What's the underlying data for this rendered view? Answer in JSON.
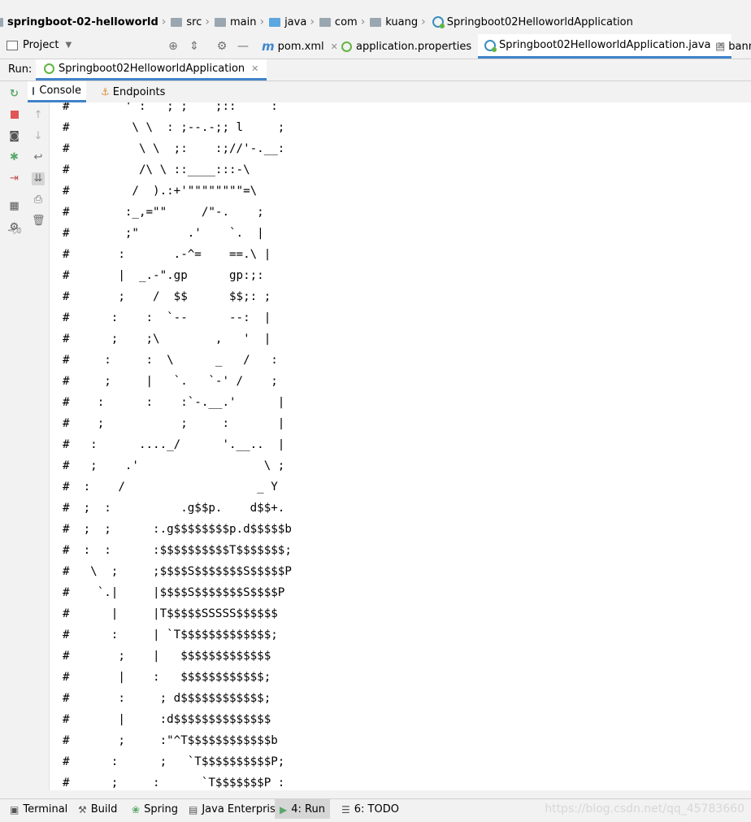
{
  "breadcrumbs": {
    "items": [
      {
        "label": "springboot-02-helloworld"
      },
      {
        "label": "src"
      },
      {
        "label": "main"
      },
      {
        "label": "java"
      },
      {
        "label": "com"
      },
      {
        "label": "kuang"
      },
      {
        "label": "Springboot02HelloworldApplication"
      }
    ]
  },
  "toolbar": {
    "project_label": "Project",
    "tabs": [
      {
        "label": "pom.xml"
      },
      {
        "label": "application.properties"
      },
      {
        "label": "Springboot02HelloworldApplication.java"
      },
      {
        "label": "bann"
      }
    ]
  },
  "run": {
    "label": "Run:",
    "config_name": "Springboot02HelloworldApplication"
  },
  "console_tabs": [
    {
      "label": "Console"
    },
    {
      "label": "Endpoints"
    }
  ],
  "console": {
    "text": "#        ' :   ; ;    ;::     :\n#         \\ \\  : ;--.-;; l     ;\n#          \\ \\  ;:    :;//'-.__:\n#          /\\ \\ ::____:::-\\\n#         /  ).:+'\"\"\"\"\"\"\"\"=\\\n#        :_,=\"\"     /\"-.    ;\n#        ;\"       .'    `.  |\n#       :       .-^=    ==.\\ |\n#       |  _.-\".gp      gp:;:\n#       ;    /  $$      $$;: ;\n#      :    :  `--      --:  |\n#      ;    ;\\        ,   '  |\n#     :     :  \\      _   /   :\n#     ;     |   `.   `-' /    ;\n#    :      :    :`-.__.'      |\n#    ;           ;     :       |\n#   :      ...._/      '.__..  |\n#   ;    .'                  \\ ;\n#  :    /                   _ Y\n#  ;  :          .g$$p.    d$$+.\n#  ;  ;      :.g$$$$$$$$p.d$$$$$b\n#  :  :      :$$$$$$$$$$T$$$$$$$;\n#   \\  ;     ;$$$$S$$$$$$$S$$$$$P\n#    `.|     |$$$$S$$$$$$$S$$$$P\n#      |     |T$$$$$SSSSS$$$$$$\n#      :     | `T$$$$$$$$$$$$$;\n#       ;    |   $$$$$$$$$$$$$\n#       |    :   $$$$$$$$$$$$;\n#       :     ; d$$$$$$$$$$$$;\n#       |     :d$$$$$$$$$$$$$$\n#       ;     :\"^T$$$$$$$$$$$$b\n#      :      ;   `T$$$$$$$$$$P;\n#      ;     :      `T$$$$$$$P :"
  },
  "bottom_tabs": [
    {
      "label": "Terminal"
    },
    {
      "label": "Build"
    },
    {
      "label": "Spring"
    },
    {
      "label": "Java Enterprise"
    },
    {
      "label": "4: Run"
    },
    {
      "label": "6: TODO"
    }
  ],
  "watermark": "https://blog.csdn.net/qq_45783660",
  "colors": {
    "accent": "#4083c9",
    "run_green": "#59a869",
    "stop_red": "#e05555"
  }
}
